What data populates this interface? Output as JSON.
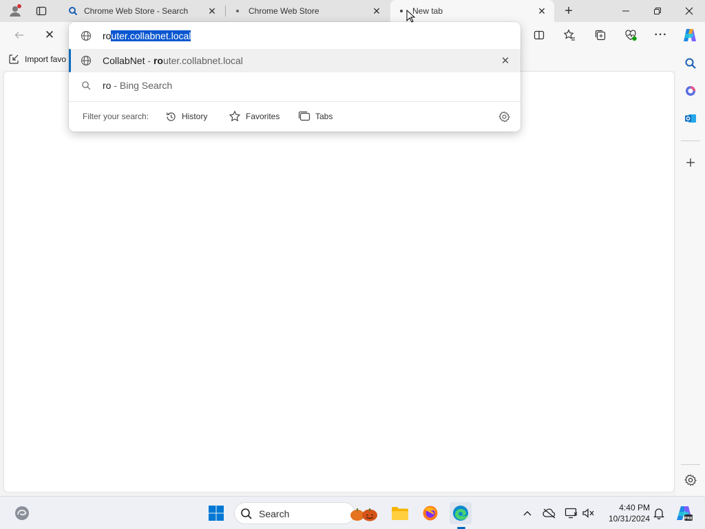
{
  "tabs": [
    {
      "title": "Chrome Web Store - Search",
      "favicon": "search-icon",
      "close": "✕"
    },
    {
      "title": "Chrome Web Store",
      "favicon": "dot-icon",
      "close": "✕"
    },
    {
      "title": "New tab",
      "favicon": "loading-dot-icon",
      "close": "✕",
      "active": true
    }
  ],
  "new_tab_label": "+",
  "window": {
    "minimize": "—",
    "restore": "⧉",
    "close": "✕"
  },
  "toolbar": {
    "stop": "✕",
    "more": "···"
  },
  "omnibox": {
    "typed": "ro",
    "autocomplete": "uter.collabnet.local",
    "suggestions": [
      {
        "site": "CollabNet",
        "sep": " - ",
        "match": "ro",
        "rest": "uter.collabnet.local",
        "icon": "globe-icon",
        "remove": "✕"
      },
      {
        "query": "ro",
        "engine": " - Bing Search",
        "icon": "search-icon"
      }
    ],
    "filter": {
      "label": "Filter your search:",
      "chips": [
        {
          "label": "History",
          "icon": "history-icon"
        },
        {
          "label": "Favorites",
          "icon": "star-icon"
        },
        {
          "label": "Tabs",
          "icon": "tabs-icon"
        }
      ]
    }
  },
  "favorites_bar": {
    "import_label": "Import favo"
  },
  "taskbar": {
    "search_label": "Search",
    "time": "4:40 PM",
    "date": "10/31/2024"
  },
  "colors": {
    "accent": "#0f6cbd",
    "selection": "#0b57d0"
  }
}
